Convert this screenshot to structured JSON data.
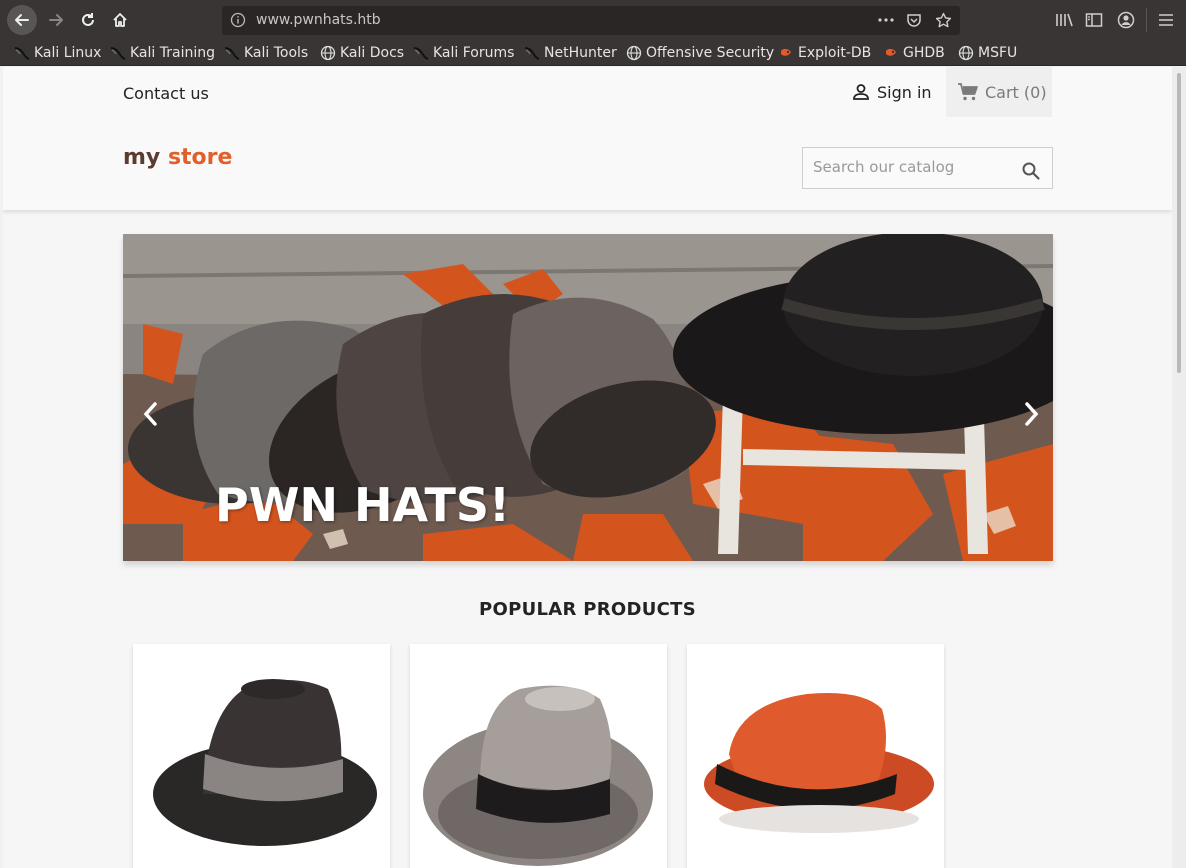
{
  "browser": {
    "url": "www.pwnhats.htb",
    "bookmarks": [
      {
        "label": "Kali Linux",
        "icon": "kali-dragon-icon"
      },
      {
        "label": "Kali Training",
        "icon": "kali-dragon-icon"
      },
      {
        "label": "Kali Tools",
        "icon": "kali-dragon-icon"
      },
      {
        "label": "Kali Docs",
        "icon": "globe-icon"
      },
      {
        "label": "Kali Forums",
        "icon": "kali-dragon-icon"
      },
      {
        "label": "NetHunter",
        "icon": "kali-dragon-icon"
      },
      {
        "label": "Offensive Security",
        "icon": "globe-icon"
      },
      {
        "label": "Exploit-DB",
        "icon": "exploitdb-icon"
      },
      {
        "label": "GHDB",
        "icon": "exploitdb-icon"
      },
      {
        "label": "MSFU",
        "icon": "globe-icon"
      }
    ]
  },
  "header": {
    "contact": "Contact us",
    "signin": "Sign in",
    "cart": "Cart (0)",
    "logo_part1": "my",
    "logo_part2": "store",
    "search_placeholder": "Search our catalog"
  },
  "carousel": {
    "caption": "PWN HATS!"
  },
  "popular": {
    "title": "POPULAR PRODUCTS"
  },
  "colors": {
    "chrome": "#3a3535",
    "accent_orange": "#e0602c",
    "logo_brown": "#5c3b33"
  }
}
